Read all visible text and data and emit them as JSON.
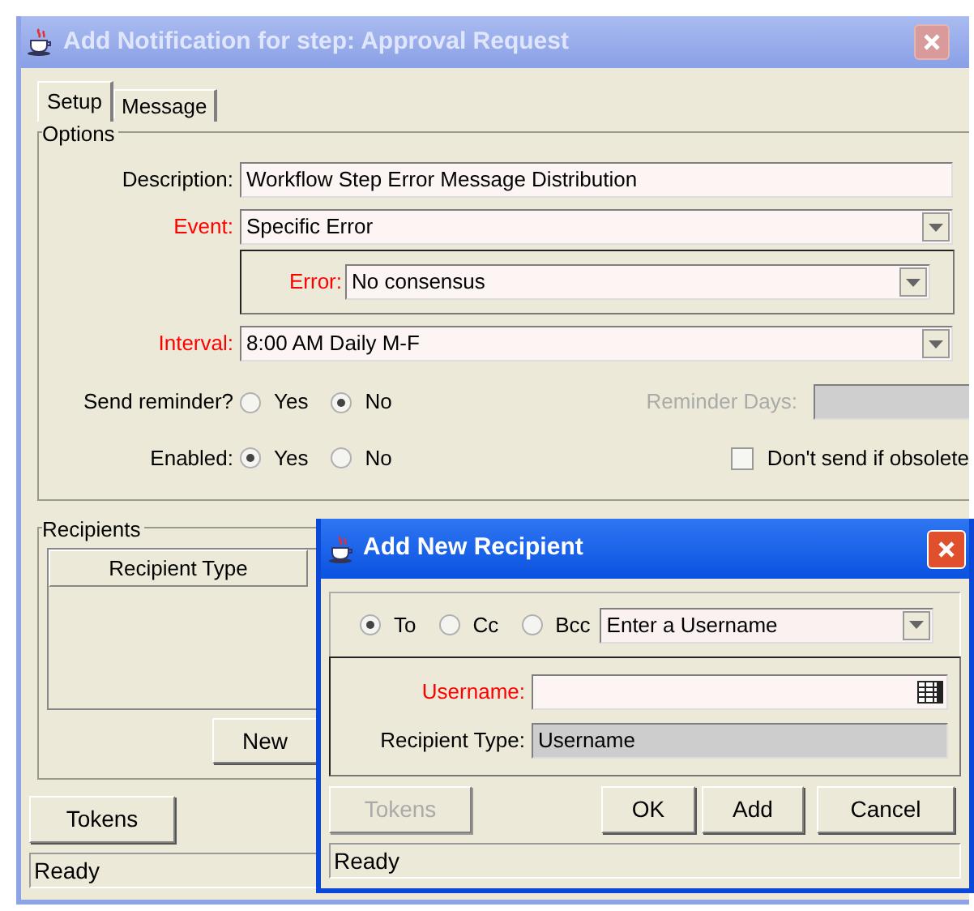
{
  "window": {
    "title": "Add Notification for step: Approval Request"
  },
  "tabs": [
    {
      "label": "Setup",
      "selected": true
    },
    {
      "label": "Message",
      "selected": false
    }
  ],
  "options": {
    "legend": "Options",
    "fields": [
      {
        "kind": "text",
        "label": "Description:",
        "required": false,
        "value": "Workflow Step Error Message Distribution"
      },
      {
        "kind": "select",
        "label": "Event:",
        "required": true,
        "value": "Specific Error"
      },
      {
        "kind": "subselect",
        "label": "Error:",
        "required": true,
        "value": "No consensus"
      },
      {
        "kind": "select",
        "label": "Interval:",
        "required": true,
        "value": "8:00 AM Daily M-F"
      }
    ],
    "send_reminder": {
      "label": "Send reminder?",
      "options": [
        {
          "label": "Yes",
          "selected": false
        },
        {
          "label": "No",
          "selected": true
        }
      ]
    },
    "reminder_days": {
      "label": "Reminder Days:",
      "disabled": true
    },
    "enabled": {
      "label": "Enabled:",
      "options": [
        {
          "label": "Yes",
          "selected": true
        },
        {
          "label": "No",
          "selected": false
        }
      ]
    },
    "obsolete": {
      "label": "Don't send if obsolete",
      "checked": false
    }
  },
  "recipients": {
    "legend": "Recipients",
    "columns": [
      "Recipient Type"
    ],
    "new_button": "New"
  },
  "tokens_button": {
    "label": "Tokens",
    "disabled": false
  },
  "status_bar": "Ready",
  "dialog": {
    "title": "Add New Recipient",
    "kinds": [
      {
        "label": "To",
        "selected": true
      },
      {
        "label": "Cc",
        "selected": false
      },
      {
        "label": "Bcc",
        "selected": false
      }
    ],
    "type_select": "Enter a Username",
    "username": {
      "label": "Username:",
      "required": true
    },
    "recipient_type": {
      "label": "Recipient Type:",
      "value": "Username",
      "disabled": true
    },
    "tokens_button": {
      "label": "Tokens",
      "disabled": true
    },
    "buttons": [
      "OK",
      "Add",
      "Cancel"
    ],
    "status_bar": "Ready"
  }
}
